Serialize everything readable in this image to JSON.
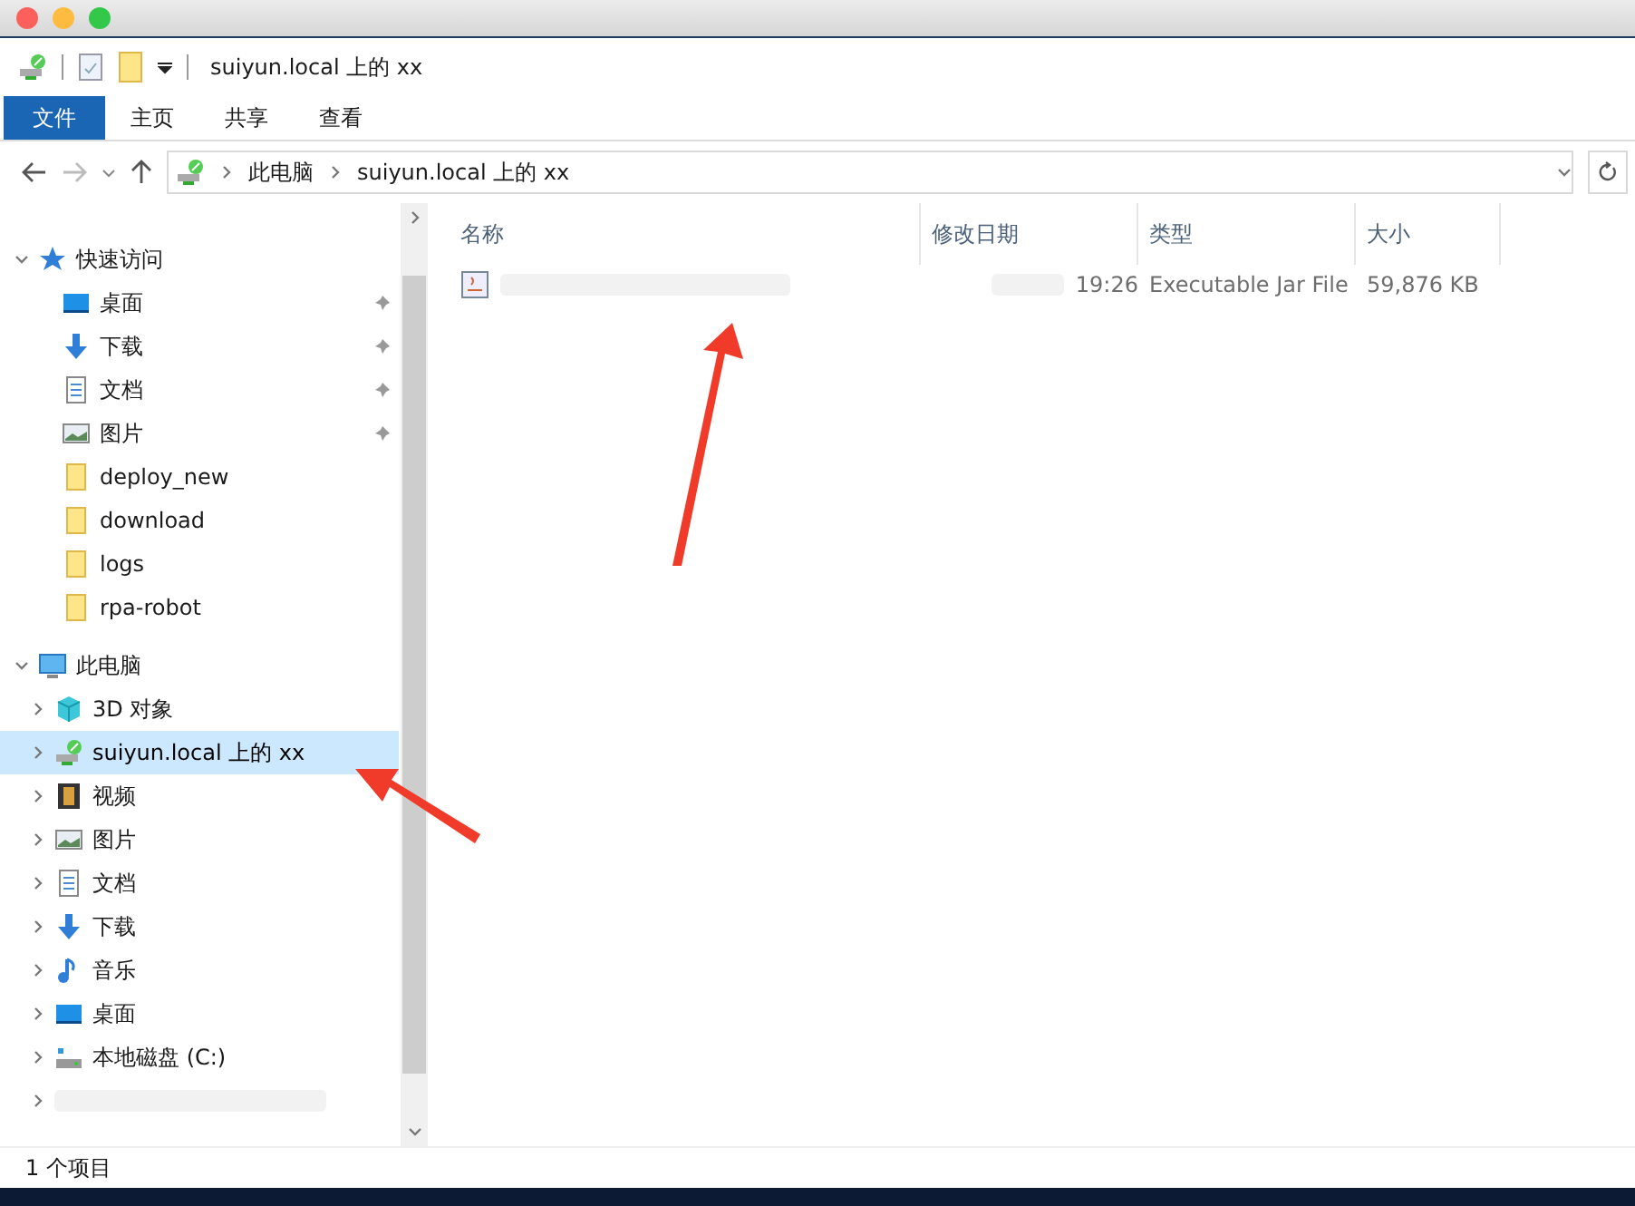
{
  "window": {
    "title": "suiyun.local 上的 xx"
  },
  "ribbon_tabs": [
    {
      "label": "文件",
      "selected": true
    },
    {
      "label": "主页",
      "selected": false
    },
    {
      "label": "共享",
      "selected": false
    },
    {
      "label": "查看",
      "selected": false
    }
  ],
  "address": {
    "path": [
      "此电脑",
      "suiyun.local 上的 xx"
    ]
  },
  "sidebar": {
    "items": [
      {
        "label": "快速访问",
        "kind": "star",
        "expanded": true,
        "selected": false,
        "children": [
          {
            "label": "桌面",
            "kind": "desktop",
            "pinned": true,
            "selected": false
          },
          {
            "label": "下载",
            "kind": "download",
            "pinned": true,
            "selected": false
          },
          {
            "label": "文档",
            "kind": "document",
            "pinned": true,
            "selected": false
          },
          {
            "label": "图片",
            "kind": "picture",
            "pinned": true,
            "selected": false
          },
          {
            "label": "deploy_new",
            "kind": "folder",
            "pinned": false,
            "selected": false
          },
          {
            "label": "download",
            "kind": "folder",
            "pinned": false,
            "selected": false
          },
          {
            "label": "logs",
            "kind": "folder",
            "pinned": false,
            "selected": false
          },
          {
            "label": "rpa-robot",
            "kind": "folder",
            "pinned": false,
            "selected": false
          }
        ]
      },
      {
        "label": "此电脑",
        "kind": "pc",
        "expanded": true,
        "selected": false,
        "children": [
          {
            "label": "3D 对象",
            "kind": "cube",
            "expanded": false,
            "selected": false
          },
          {
            "label": "suiyun.local 上的 xx",
            "kind": "network-drive",
            "expanded": false,
            "selected": true
          },
          {
            "label": "视频",
            "kind": "video",
            "expanded": false,
            "selected": false
          },
          {
            "label": "图片",
            "kind": "picture",
            "expanded": false,
            "selected": false
          },
          {
            "label": "文档",
            "kind": "document",
            "expanded": false,
            "selected": false
          },
          {
            "label": "下载",
            "kind": "download",
            "expanded": false,
            "selected": false
          },
          {
            "label": "音乐",
            "kind": "music",
            "expanded": false,
            "selected": false
          },
          {
            "label": "桌面",
            "kind": "desktop",
            "expanded": false,
            "selected": false
          },
          {
            "label": "本地磁盘 (C:)",
            "kind": "disk",
            "expanded": false,
            "selected": false
          },
          {
            "kind": "redacted",
            "expanded": false,
            "selected": false
          }
        ]
      }
    ]
  },
  "table": {
    "columns": [
      "名称",
      "修改日期",
      "类型",
      "大小"
    ],
    "rows": [
      {
        "modified": "19:26",
        "type": "Executable Jar File",
        "size": "59,876 KB"
      }
    ]
  },
  "status_bar": {
    "count": "1 个项目"
  }
}
